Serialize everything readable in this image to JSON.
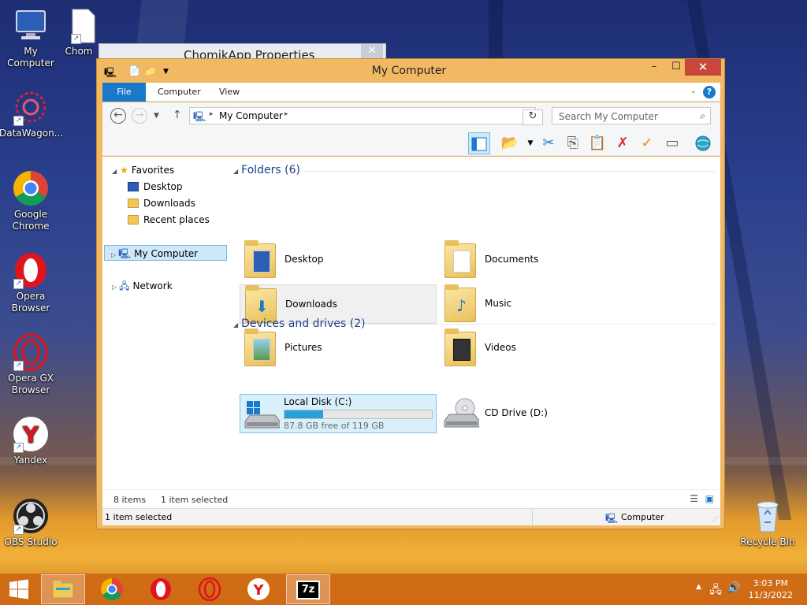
{
  "desktop": {
    "icons": [
      {
        "label": "My Computer"
      },
      {
        "label": "Chom"
      },
      {
        "label": "DataWagon..."
      },
      {
        "label": "Google\nChrome"
      },
      {
        "label": "Opera\nBrowser"
      },
      {
        "label": "Opera GX\nBrowser"
      },
      {
        "label": "Yandex"
      },
      {
        "label": "OBS Studio"
      },
      {
        "label": "Recycle Bin"
      }
    ],
    "background_window_title": "ChomikApp Properties"
  },
  "window": {
    "title": "My Computer",
    "controls": {
      "minimize": "–",
      "maximize": "☐",
      "close": "✕"
    },
    "ribbon_tabs": [
      "File",
      "Computer",
      "View"
    ],
    "address": {
      "path_label": "My Computer",
      "search_placeholder": "Search My Computer"
    },
    "nav_pane": {
      "favorites": "Favorites",
      "favorites_items": [
        "Desktop",
        "Downloads",
        "Recent places"
      ],
      "computer": "My Computer",
      "network": "Network"
    },
    "content": {
      "folders_header": "Folders (6)",
      "folders": [
        "Desktop",
        "Documents",
        "Downloads",
        "Music",
        "Pictures",
        "Videos"
      ],
      "devices_header": "Devices and drives (2)",
      "drive_c": {
        "name": "Local Disk (C:)",
        "free": "87.8 GB free of 119 GB",
        "used_fraction": 0.262
      },
      "drive_d": {
        "name": "CD Drive (D:)"
      }
    },
    "info_bar": {
      "items": "8 items",
      "selected": "1 item selected"
    },
    "status_bar": {
      "left": "1 item selected",
      "right": "Computer"
    }
  },
  "taskbar": {
    "clock_time": "3:03 PM",
    "clock_date": "11/3/2022",
    "app_7z_label": "7z"
  },
  "colors": {
    "accent": "#1979ca",
    "window_frame": "#f2b965",
    "taskbar": "#cf6815",
    "selection": "#d9f0fb"
  }
}
